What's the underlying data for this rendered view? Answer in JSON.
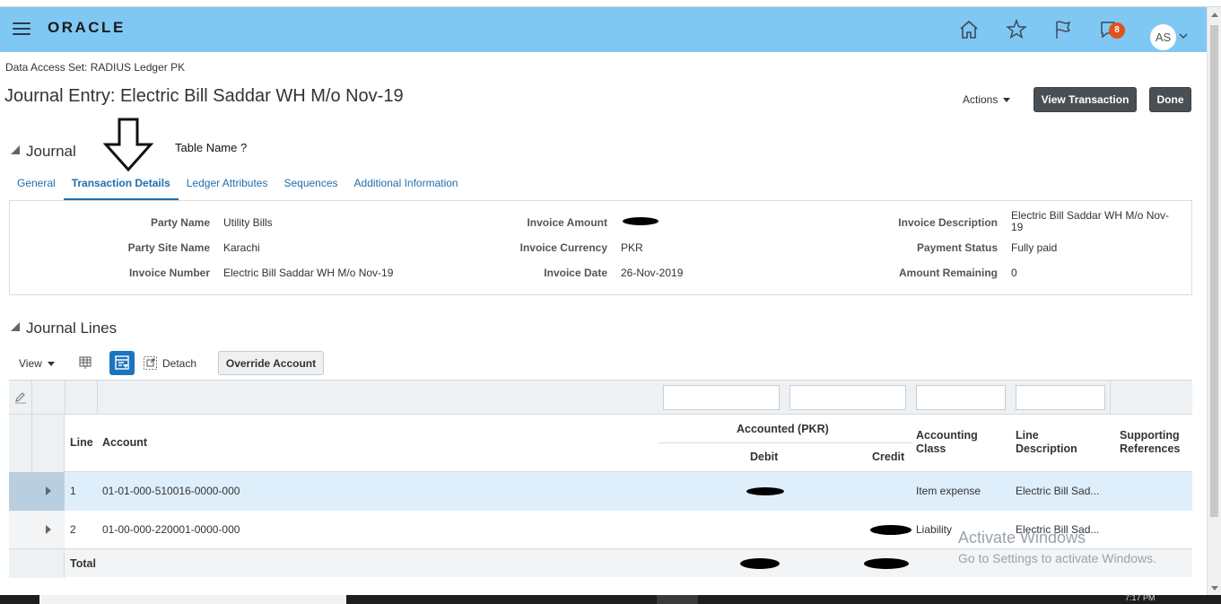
{
  "header": {
    "logo": "ORACLE",
    "notification_count": "8",
    "user_initials": "AS"
  },
  "page": {
    "data_access": "Data Access Set:  RADIUS Ledger PK",
    "title": "Journal Entry: Electric Bill Saddar WH M/o Nov-19",
    "actions_label": "Actions",
    "view_transaction_label": "View Transaction",
    "done_label": "Done"
  },
  "annotation": {
    "text": "Table Name ?"
  },
  "journal": {
    "heading": "Journal",
    "tabs": [
      {
        "label": "General"
      },
      {
        "label": "Transaction Details"
      },
      {
        "label": "Ledger Attributes"
      },
      {
        "label": "Sequences"
      },
      {
        "label": "Additional Information"
      }
    ],
    "active_tab": "Transaction Details",
    "fields": {
      "party_name_label": "Party Name",
      "party_name": "Utility Bills",
      "party_site_label": "Party Site Name",
      "party_site": "Karachi",
      "invoice_number_label": "Invoice Number",
      "invoice_number": "Electric Bill Saddar WH M/o Nov-19",
      "invoice_amount_label": "Invoice Amount",
      "invoice_currency_label": "Invoice Currency",
      "invoice_currency": "PKR",
      "invoice_date_label": "Invoice Date",
      "invoice_date": "26-Nov-2019",
      "invoice_description_label": "Invoice Description",
      "invoice_description_l1": "Electric Bill Saddar WH M/o Nov-",
      "invoice_description_l2": "19",
      "payment_status_label": "Payment Status",
      "payment_status": "Fully paid",
      "amount_remaining_label": "Amount Remaining",
      "amount_remaining": "0"
    }
  },
  "journal_lines": {
    "heading": "Journal Lines",
    "toolbar": {
      "view_label": "View",
      "detach_label": "Detach",
      "override_label": "Override Account"
    },
    "columns": {
      "line": "Line",
      "account": "Account",
      "accounted": "Accounted (PKR)",
      "debit": "Debit",
      "credit": "Credit",
      "accounting_class_l1": "Accounting",
      "accounting_class_l2": "Class",
      "line_description_l1": "Line",
      "line_description_l2": "Description",
      "supporting_refs_l1": "Supporting",
      "supporting_refs_l2": "References"
    },
    "rows": [
      {
        "line": "1",
        "account": "01-01-000-510016-0000-000",
        "accounting_class": "Item expense",
        "line_description": "Electric Bill Sad..."
      },
      {
        "line": "2",
        "account": "01-00-000-220001-0000-000",
        "accounting_class": "Liability",
        "line_description": "Electric Bill Sad..."
      }
    ],
    "total_label": "Total"
  },
  "watermark": {
    "line1": "Activate Windows",
    "line2": "Go to Settings to activate Windows."
  },
  "taskbar": {
    "clock": "7:17 PM"
  },
  "colors": {
    "header_bg": "#80c8f4",
    "link_blue": "#1e6fae",
    "badge": "#e0521c",
    "dark_button": "#4a4f54",
    "selected_row": "#dfeefb"
  }
}
